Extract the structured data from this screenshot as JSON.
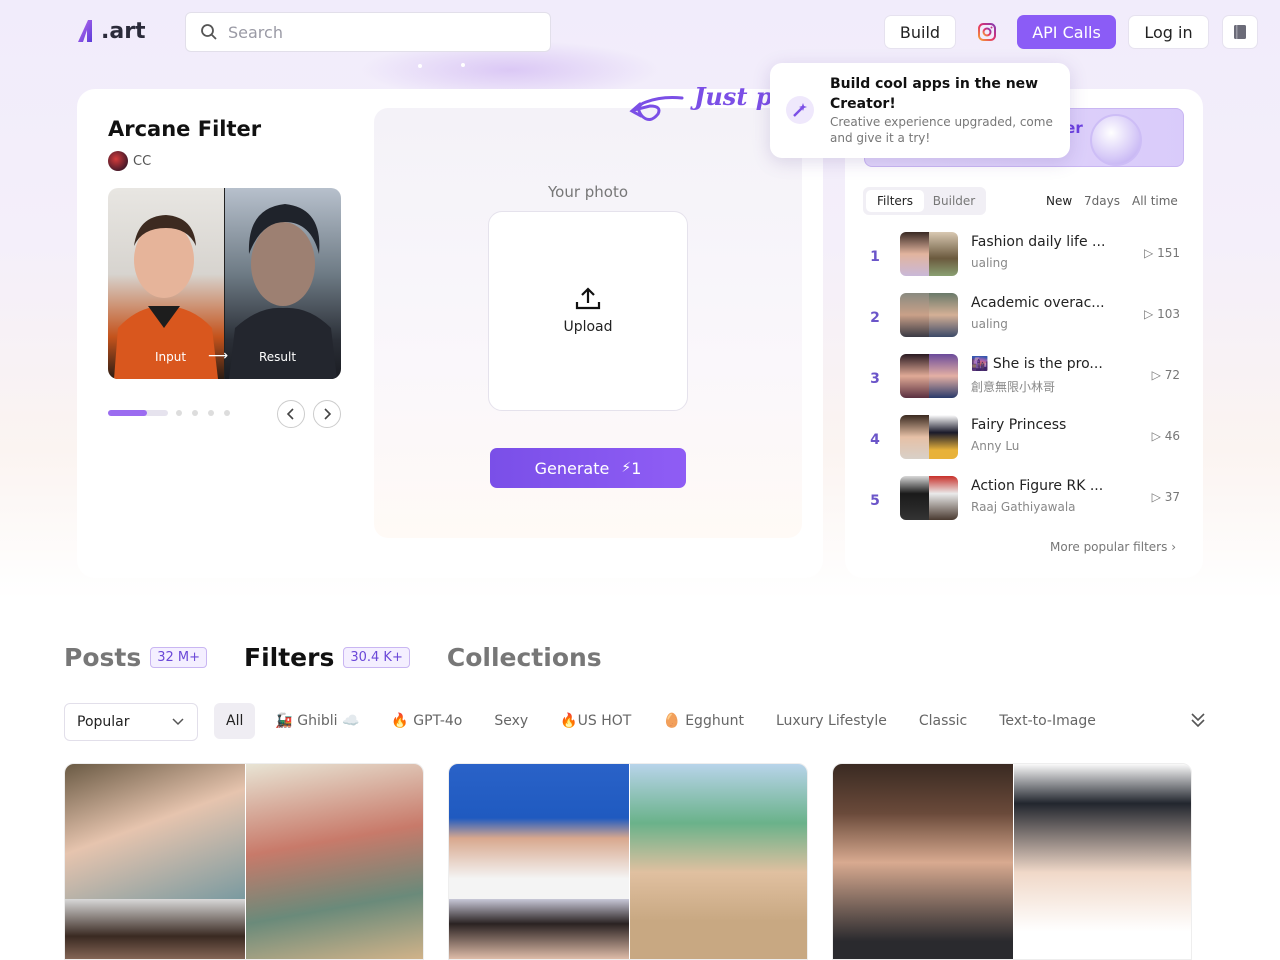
{
  "header": {
    "logo": ".art",
    "search_placeholder": "Search",
    "build": "Build",
    "api_calls": "API Calls",
    "login": "Log in"
  },
  "filter": {
    "title": "Arcane Filter",
    "author": "CC",
    "preview_input": "Input",
    "preview_result": "Result",
    "carousel_progress": 0.65,
    "your_photo": "Your photo",
    "upload": "Upload",
    "generate": "Generate",
    "generate_cost": "1",
    "hint": "Just p"
  },
  "popup": {
    "title": "Build cool apps in the new Creator!",
    "desc": "Creative experience upgraded, come and give it a try!"
  },
  "ranking": {
    "banner_text": "ler",
    "tabs": [
      "Filters",
      "Builder"
    ],
    "active_tab": "Filters",
    "ranges": [
      "New",
      "7days",
      "All time"
    ],
    "active_range": "New",
    "items": [
      {
        "rank": "1",
        "name": "Fashion daily life ...",
        "author": "ualing",
        "count": "151"
      },
      {
        "rank": "2",
        "name": "Academic overac...",
        "author": "ualing",
        "count": "103"
      },
      {
        "rank": "3",
        "name": "🌆 She is the pro...",
        "author": "創意無限小林哥",
        "count": "72"
      },
      {
        "rank": "4",
        "name": "Fairy Princess",
        "author": "Anny Lu",
        "count": "46"
      },
      {
        "rank": "5",
        "name": "Action Figure RK ...",
        "author": "Raaj Gathiyawala",
        "count": "37"
      }
    ],
    "more": "More popular filters"
  },
  "sections": {
    "tabs": [
      {
        "label": "Posts",
        "badge": "32 M+"
      },
      {
        "label": "Filters",
        "badge": "30.4 K+"
      },
      {
        "label": "Collections",
        "badge": ""
      }
    ],
    "active": "Filters",
    "sort": "Popular",
    "chips": [
      "All",
      "🚂 Ghibli ☁️",
      "🔥 GPT-4o",
      "Sexy",
      "🔥US HOT",
      "🥚 Egghunt",
      "Luxury Lifestyle",
      "Classic",
      "Text-to-Image"
    ],
    "active_chip": "All"
  },
  "colors": {
    "accent": "#8b5cf6",
    "rank": "#6b55c9"
  }
}
